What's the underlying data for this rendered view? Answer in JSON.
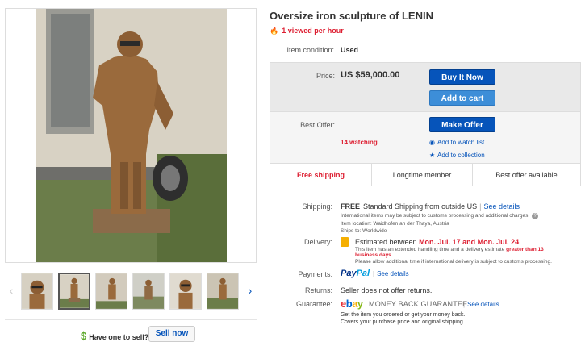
{
  "listing": {
    "title": "Oversize iron sculpture of LENIN",
    "viewed": "1 viewed per hour",
    "condition_label": "Item condition:",
    "condition_value": "Used"
  },
  "gallery": {
    "thumb_count": 6,
    "active_index": 1
  },
  "sell": {
    "question": "Have one to sell?",
    "button": "Sell now"
  },
  "buy": {
    "price_label": "Price:",
    "price": "US $59,000.00",
    "buy_now": "Buy It Now",
    "add_to_cart": "Add to cart",
    "best_offer_label": "Best Offer:",
    "make_offer": "Make Offer",
    "watching": "14 watching",
    "watch_list": "Add to watch list",
    "collection": "Add to collection"
  },
  "features": [
    "Free shipping",
    "Longtime member",
    "Best offer available"
  ],
  "shipping": {
    "label": "Shipping:",
    "free": "FREE",
    "method": "Standard Shipping from outside US",
    "details_link": "See details",
    "customs_note": "International items may be subject to customs processing and additional charges.",
    "location": "Item location:  Waidhofen an der Thaya, Austria",
    "ships_to": "Ships to:  Worldwide"
  },
  "delivery": {
    "label": "Delivery:",
    "prefix": "Estimated between",
    "dates": "Mon. Jul. 17 and Mon. Jul. 24",
    "note1": "This item has an extended handling time and a delivery estimate",
    "note1_red": "greater than 13",
    "note2_red": "business days.",
    "note3": "Please allow additional time if international delivery is subject to customs processing."
  },
  "payments": {
    "label": "Payments:",
    "paypal_a": "Pay",
    "paypal_b": "Pal",
    "details_link": "See details"
  },
  "returns": {
    "label": "Returns:",
    "value": "Seller does not offer returns."
  },
  "guarantee": {
    "label": "Guarantee:",
    "logo_e": "e",
    "logo_b": "b",
    "logo_a": "a",
    "logo_y": "y",
    "mbg": "MONEY BACK GUARANTEE",
    "details_link": "See details",
    "line1": "Get the item you ordered or get your money back.",
    "line2": "Covers your purchase price and original shipping."
  },
  "colors": {
    "ebay_blue": "#0654ba",
    "alert_red": "#dd1e31"
  }
}
